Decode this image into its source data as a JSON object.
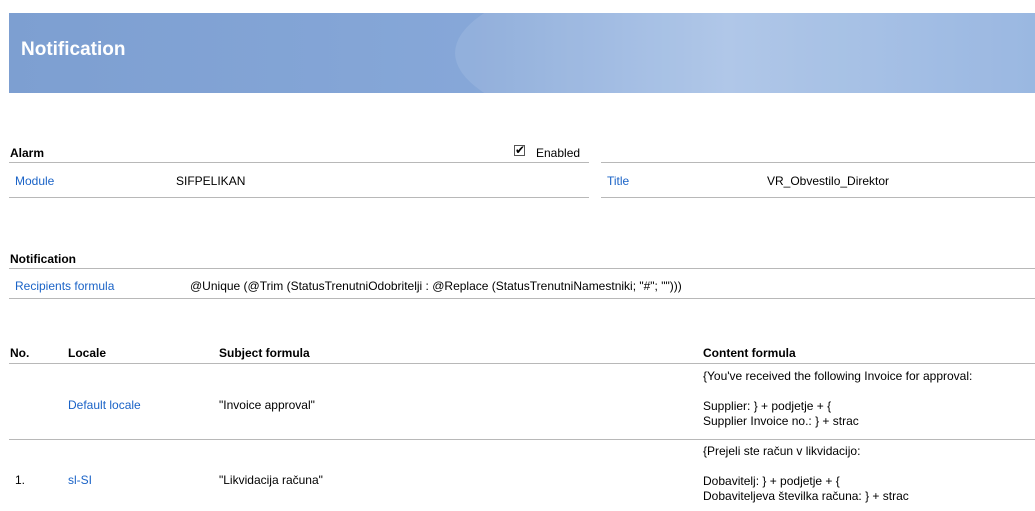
{
  "header": {
    "title": "Notification"
  },
  "alarm": {
    "section_title": "Alarm",
    "enabled_label": "Enabled",
    "enabled_checked": true,
    "module_label": "Module",
    "module_value": "SIFPELIKAN",
    "title_label": "Title",
    "title_value": "VR_Obvestilo_Direktor"
  },
  "notification": {
    "section_title": "Notification",
    "recipients_label": "Recipients formula",
    "recipients_value": "@Unique (@Trim (StatusTrenutniOdobritelji : @Replace (StatusTrenutniNamestniki; \"#\"; \"\")))"
  },
  "table": {
    "headers": {
      "no": "No.",
      "locale": "Locale",
      "subject": "Subject formula",
      "content": "Content formula"
    },
    "rows": [
      {
        "no": "",
        "locale": "Default locale",
        "subject": "\"Invoice approval\"",
        "content": [
          "{You've received the following Invoice for approval:",
          "",
          "Supplier: } + podjetje + {",
          "Supplier Invoice no.: } + strac"
        ]
      },
      {
        "no": "1.",
        "locale": "sl-SI",
        "subject": "\"Likvidacija računa\"",
        "content": [
          "{Prejeli ste račun v likvidacijo:",
          "",
          "Dobavitelj: } + podjetje + {",
          "Dobaviteljeva številka računa: } + strac"
        ]
      }
    ]
  }
}
